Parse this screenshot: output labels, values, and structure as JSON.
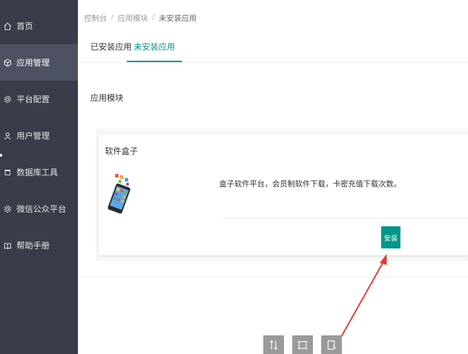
{
  "sidebar": {
    "items": [
      {
        "label": "首页",
        "icon": "home-icon"
      },
      {
        "label": "应用管理",
        "icon": "cube-icon",
        "active": true
      },
      {
        "label": "平台配置",
        "icon": "gear-icon"
      },
      {
        "label": "用户管理",
        "icon": "user-icon"
      },
      {
        "label": "数据库工具",
        "icon": "database-icon"
      },
      {
        "label": "微信公众平台",
        "icon": "gear-icon"
      },
      {
        "label": "帮助手册",
        "icon": "book-icon"
      }
    ]
  },
  "breadcrumb": {
    "items": [
      "控制台",
      "应用模块",
      "未安装应用"
    ],
    "separator": "/"
  },
  "tabs": [
    {
      "label": "已安装应用",
      "active": false
    },
    {
      "label": "未安装应用",
      "active": true
    }
  ],
  "section": {
    "label": "应用模块"
  },
  "app_card": {
    "title": "软件盒子",
    "description": "盒子软件平台，会员制软件下载，卡密充值下载次数。",
    "install_label": "安装",
    "icon": "phone-apps-icon"
  },
  "colors": {
    "sidebar_bg": "#393d49",
    "sidebar_active": "#4d5262",
    "accent": "#009688",
    "annotation_arrow": "#e53935"
  }
}
